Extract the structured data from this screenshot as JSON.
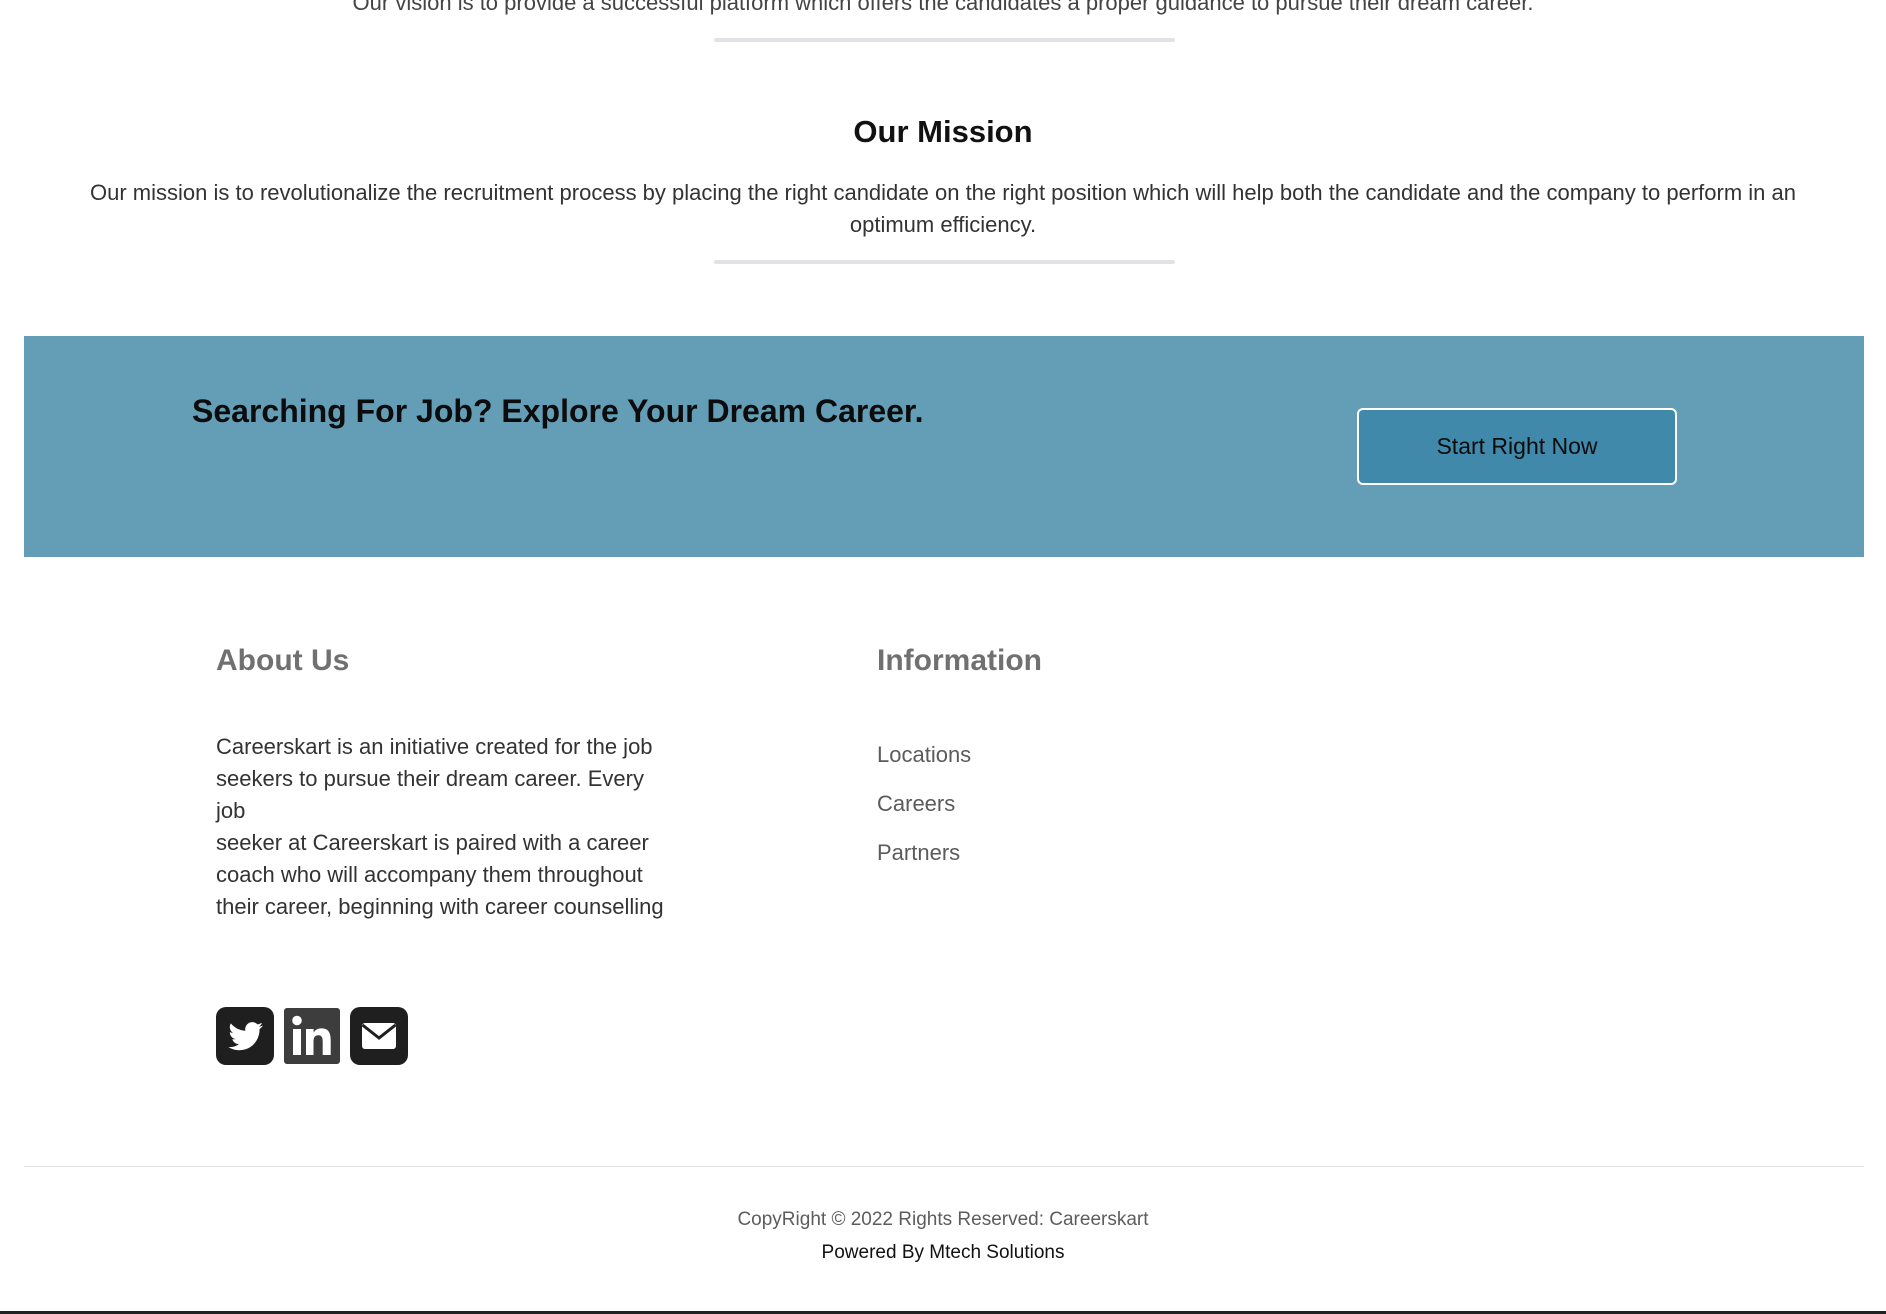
{
  "vision": {
    "text": "Our vision is to provide a successful platform which offers the candidates a proper guidance to pursue their dream career."
  },
  "mission": {
    "title": "Our Mission",
    "text": "Our mission is to revolutionalize the recruitment process by placing the right candidate on the right position which will help both the candidate and the company to perform in an optimum efficiency."
  },
  "cta": {
    "title": "Searching For Job? Explore Your Dream Career.",
    "button_label": "Start Right Now",
    "background_color": "#639db6",
    "button_color": "#4189ab"
  },
  "footer": {
    "about": {
      "heading": "About Us",
      "text": "Careerskart is an initiative created for the job seekers to pursue their dream career. Every job\nseeker at Careerskart is paired with a career coach who will accompany them throughout their career, beginning with career counselling"
    },
    "information": {
      "heading": "Information",
      "links": [
        "Locations",
        "Careers",
        "Partners"
      ]
    },
    "social": [
      {
        "name": "twitter-icon"
      },
      {
        "name": "linkedin-icon"
      },
      {
        "name": "email-icon"
      }
    ],
    "copyright": "CopyRight © 2022 Rights Reserved: Careerskart",
    "powered_by": "Powered By Mtech Solutions"
  }
}
